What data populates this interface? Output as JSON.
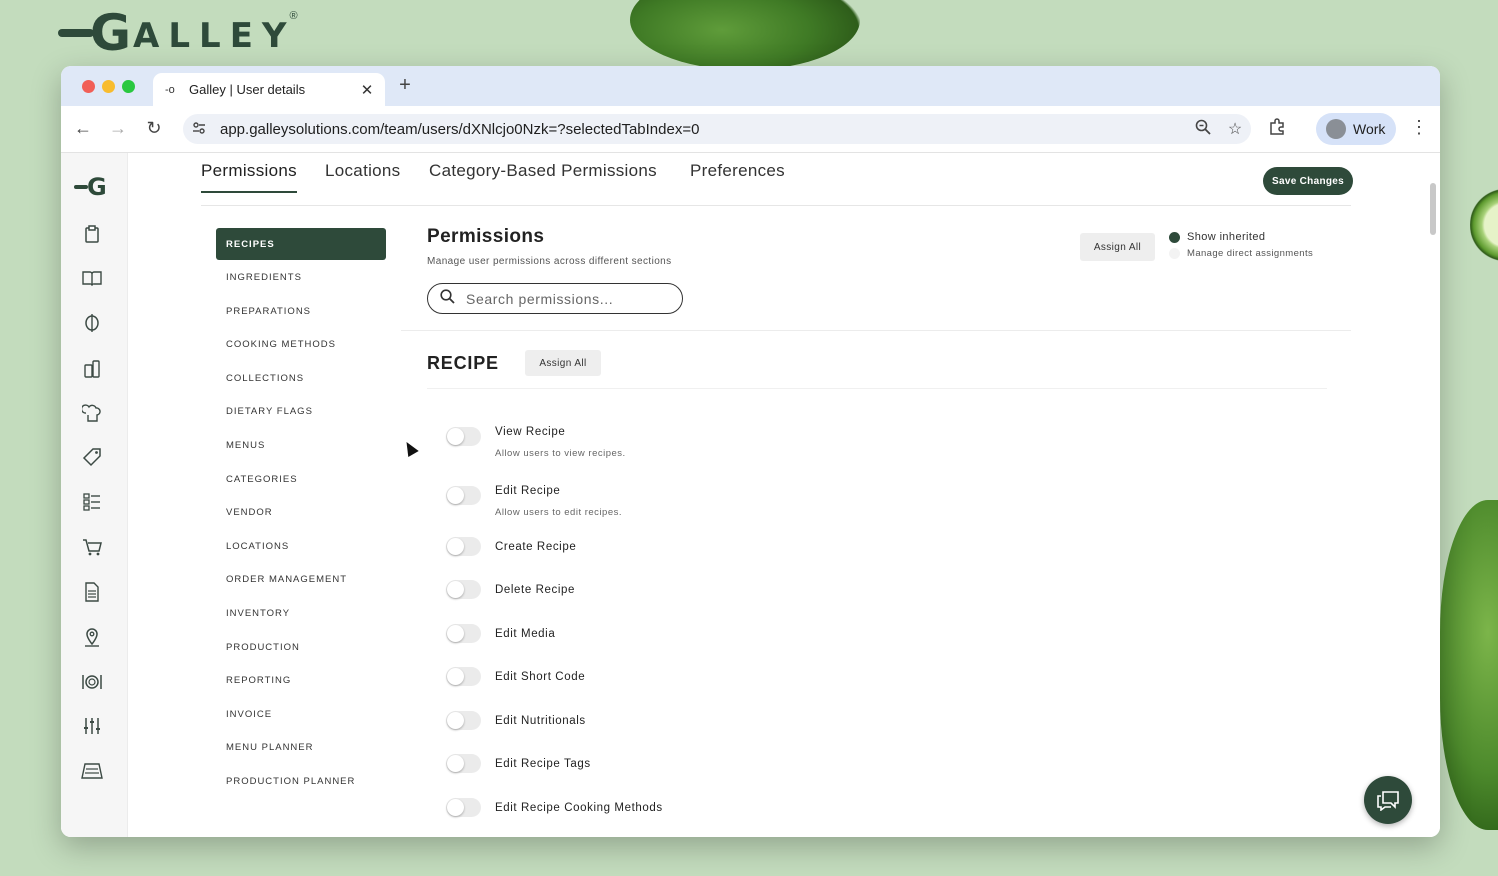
{
  "brand": {
    "letter": "G",
    "rest": "ALLEY",
    "reg": "®"
  },
  "browser": {
    "tab_title": "Galley | User details",
    "tab_favicon": "-o",
    "tab_close": "✕",
    "new_tab": "+",
    "url": "app.galleysolutions.com/team/users/dXNlcjo0Nzk=?selectedTabIndex=0",
    "profile_label": "Work",
    "nav": {
      "back": "←",
      "forward": "→",
      "reload": "↻"
    }
  },
  "app": {
    "rail_logo": "G",
    "rail_icons": [
      "clipboard-icon",
      "book-icon",
      "ingredient-icon",
      "bottles-icon",
      "chef-icon",
      "tag-icon",
      "checklist-icon",
      "cart-icon",
      "document-icon",
      "location-pin-icon",
      "plate-icon",
      "sliders-icon",
      "notebook-icon"
    ],
    "tabs": [
      "Permissions",
      "Locations",
      "Category-Based Permissions",
      "Preferences"
    ],
    "active_tab": 0,
    "save_button": "Save Changes",
    "categories": [
      "RECIPES",
      "INGREDIENTS",
      "PREPARATIONS",
      "COOKING METHODS",
      "COLLECTIONS",
      "DIETARY FLAGS",
      "MENUS",
      "CATEGORIES",
      "VENDOR",
      "LOCATIONS",
      "ORDER MANAGEMENT",
      "INVENTORY",
      "PRODUCTION",
      "REPORTING",
      "INVOICE",
      "MENU PLANNER",
      "PRODUCTION PLANNER"
    ],
    "active_category": 0,
    "header": {
      "title": "Permissions",
      "subtitle": "Manage user permissions across different sections",
      "assign_all": "Assign All",
      "legend_inherited": "Show inherited",
      "legend_direct": "Manage direct assignments"
    },
    "search": {
      "placeholder": "Search permissions..."
    },
    "section": {
      "title": "RECIPE",
      "assign_all": "Assign All",
      "permissions": [
        {
          "name": "View Recipe",
          "desc": "Allow users to view recipes.",
          "enabled": false
        },
        {
          "name": "Edit Recipe",
          "desc": "Allow users to edit recipes.",
          "enabled": false
        },
        {
          "name": "Create Recipe",
          "desc": "",
          "enabled": false
        },
        {
          "name": "Delete Recipe",
          "desc": "",
          "enabled": false
        },
        {
          "name": "Edit Media",
          "desc": "",
          "enabled": false
        },
        {
          "name": "Edit Short Code",
          "desc": "",
          "enabled": false
        },
        {
          "name": "Edit Nutritionals",
          "desc": "",
          "enabled": false
        },
        {
          "name": "Edit Recipe Tags",
          "desc": "",
          "enabled": false
        },
        {
          "name": "Edit Recipe Cooking Methods",
          "desc": "",
          "enabled": false
        }
      ]
    }
  },
  "colors": {
    "primary": "#2e4a3a",
    "page_bg": "#c3dcbd",
    "tabbar": "#dfe8f7"
  }
}
